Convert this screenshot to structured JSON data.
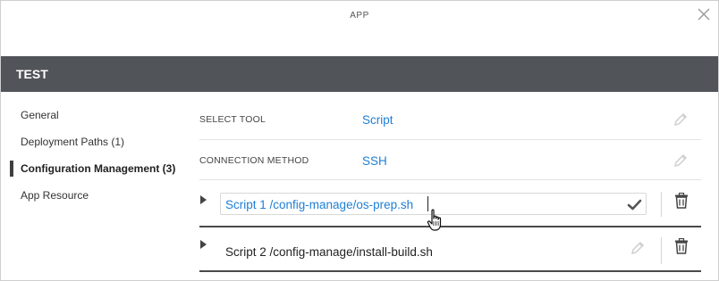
{
  "window": {
    "title": "APP",
    "close_icon": "close-icon"
  },
  "header": {
    "title": "TEST",
    "background": "#515459"
  },
  "sidebar": {
    "items": [
      {
        "label": "General",
        "active": false
      },
      {
        "label": "Deployment Paths (1)",
        "active": false
      },
      {
        "label": "Configuration Management (3)",
        "active": true
      },
      {
        "label": "App Resource",
        "active": false
      }
    ]
  },
  "config": {
    "select_tool": {
      "label": "SELECT TOOL",
      "value": "Script"
    },
    "connection_method": {
      "label": "CONNECTION METHOD",
      "value": "SSH"
    },
    "scripts": [
      {
        "value": "Script 1 /config-manage/os-prep.sh",
        "editing": true
      },
      {
        "value": "Script 2 /config-manage/install-build.sh",
        "editing": false
      }
    ]
  },
  "colors": {
    "accent": "#1f7fd6",
    "header": "#515459"
  },
  "icons": [
    "close-icon",
    "pencil-icon",
    "check-icon",
    "trash-icon",
    "expand-arrow-icon",
    "hand-cursor-icon"
  ]
}
